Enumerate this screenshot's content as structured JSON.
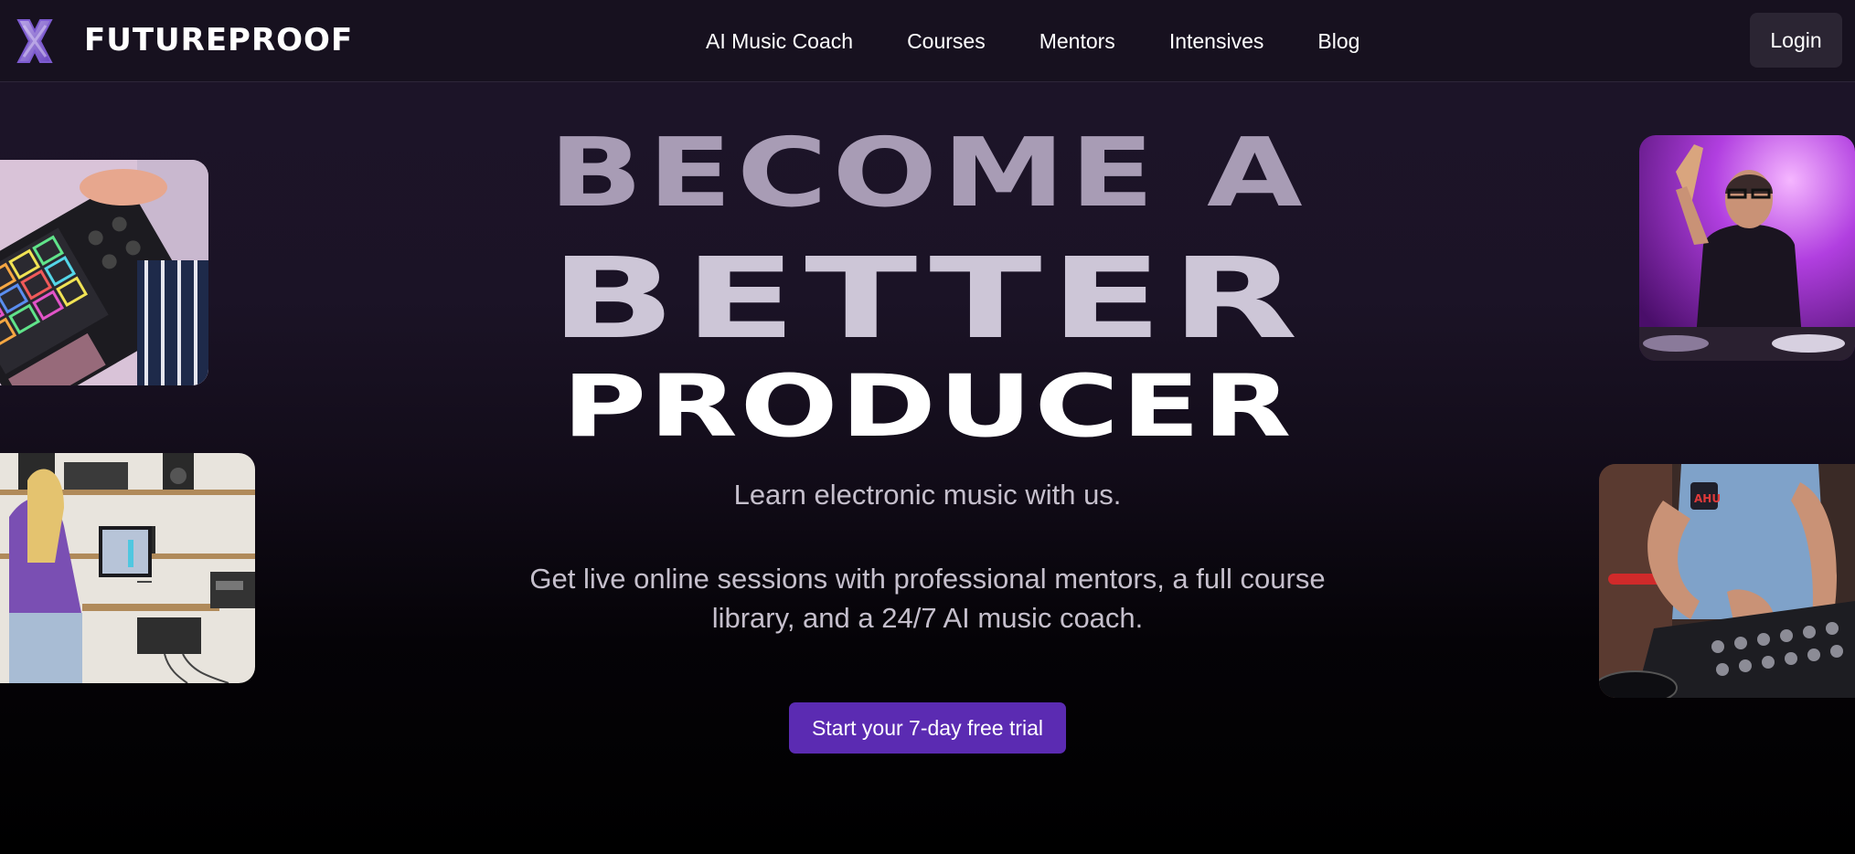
{
  "brand": {
    "name": "FUTUREPROOF",
    "logo_icon": "x-cross-logo-icon",
    "accent_color": "#5b2bb2",
    "logo_colors": [
      "#a18bd8",
      "#6b46c1"
    ]
  },
  "nav": {
    "items": [
      {
        "label": "AI Music Coach"
      },
      {
        "label": "Courses"
      },
      {
        "label": "Mentors"
      },
      {
        "label": "Intensives"
      },
      {
        "label": "Blog"
      }
    ],
    "login_label": "Login"
  },
  "hero": {
    "headline_line1": "BECOME A",
    "headline_line2": "BETTER",
    "headline_line3": "PRODUCER",
    "subtitle": "Learn electronic music with us.",
    "description": "Get live online sessions with professional mentors, a full course library, and a 24/7 AI music coach.",
    "cta_label": "Start your 7-day free trial"
  },
  "photos": [
    {
      "subject": "drum-pad-controller-photo"
    },
    {
      "subject": "home-studio-producer-photo"
    },
    {
      "subject": "dj-performing-purple-light-photo"
    },
    {
      "subject": "dj-mixer-hands-photo"
    }
  ]
}
